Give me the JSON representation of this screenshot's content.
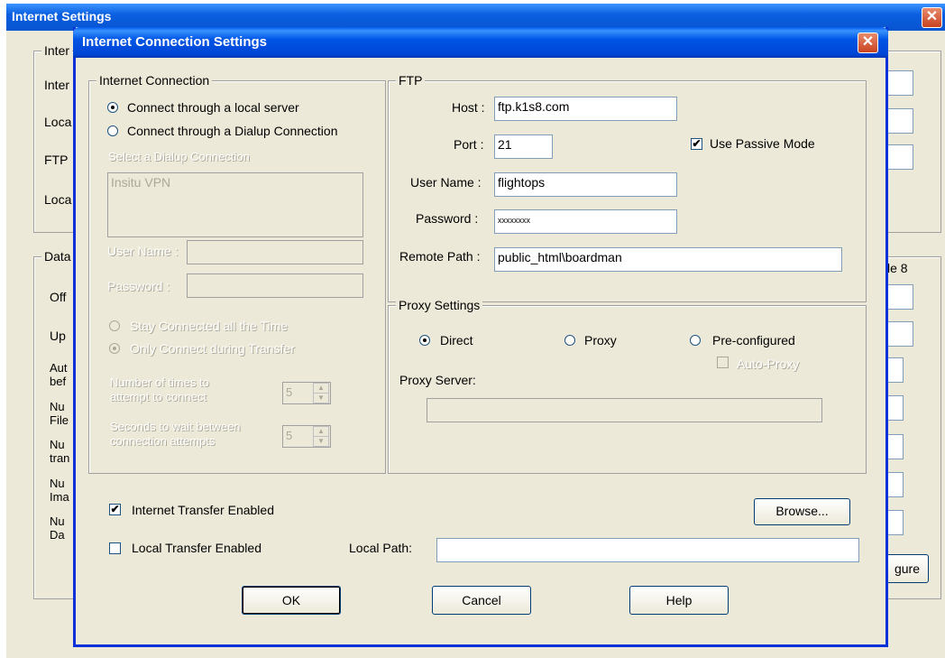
{
  "background_window": {
    "title": "Internet Settings",
    "group1_caption": "Inter",
    "labels": [
      "Inter",
      "Loca",
      "FTP",
      "Loca"
    ],
    "group2_caption": "Data",
    "labels2": [
      "Off",
      "Up",
      "Aut",
      "bef",
      "Nu",
      "File",
      "Nu",
      "tran",
      "Nu",
      "Ima",
      "Nu",
      "Da"
    ],
    "right_text": "le 8",
    "configure_button": "gure"
  },
  "dialog": {
    "title": "Internet Connection Settings",
    "internet_connection": {
      "caption": "Internet Connection",
      "radio_local": "Connect through a local server",
      "radio_dialup": "Connect through a Dialup Connection",
      "select_dialup_label": "Select a Dialup Connection",
      "dialup_list_item": "Insitu VPN",
      "user_name_label": "User Name :",
      "password_label": "Password :",
      "stay_connected": "Stay Connected all the Time",
      "only_connect": "Only Connect during Transfer",
      "attempts_label_1": "Number of times to",
      "attempts_label_2": "attempt to connect",
      "attempts_value": "5",
      "wait_label_1": "Seconds to wait between",
      "wait_label_2": "connection attempts",
      "wait_value": "5"
    },
    "ftp": {
      "caption": "FTP",
      "host_label": "Host :",
      "host_value": "ftp.k1s8.com",
      "port_label": "Port :",
      "port_value": "21",
      "passive_label": "Use Passive Mode",
      "username_label": "User Name :",
      "username_value": "flightops",
      "password_label": "Password :",
      "password_value": "xxxxxxxx",
      "remote_path_label": "Remote Path :",
      "remote_path_value": "public_html\\boardman"
    },
    "proxy": {
      "caption": "Proxy Settings",
      "direct": "Direct",
      "proxy": "Proxy",
      "preconfigured": "Pre-configured",
      "auto_proxy": "Auto-Proxy",
      "server_label": "Proxy Server:"
    },
    "internet_transfer": "Internet Transfer Enabled",
    "local_transfer": "Local Transfer Enabled",
    "local_path_label": "Local Path:",
    "browse_button": "Browse...",
    "ok_button": "OK",
    "cancel_button": "Cancel",
    "help_button": "Help"
  }
}
